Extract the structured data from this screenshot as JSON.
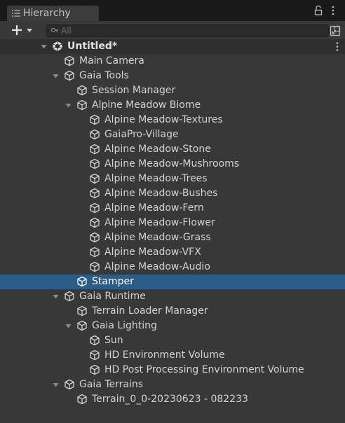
{
  "tab": {
    "title": "Hierarchy"
  },
  "search": {
    "placeholder": "All"
  },
  "rows": [
    {
      "label": "Untitled*",
      "depth": 0,
      "fold": "open",
      "scene": true
    },
    {
      "label": "Main Camera",
      "depth": 1,
      "fold": "none"
    },
    {
      "label": "Gaia Tools",
      "depth": 1,
      "fold": "open"
    },
    {
      "label": "Session Manager",
      "depth": 2,
      "fold": "none"
    },
    {
      "label": "Alpine Meadow Biome",
      "depth": 2,
      "fold": "open"
    },
    {
      "label": "Alpine Meadow-Textures",
      "depth": 3,
      "fold": "none"
    },
    {
      "label": "GaiaPro-Village",
      "depth": 3,
      "fold": "none"
    },
    {
      "label": "Alpine Meadow-Stone",
      "depth": 3,
      "fold": "none"
    },
    {
      "label": "Alpine Meadow-Mushrooms",
      "depth": 3,
      "fold": "none"
    },
    {
      "label": "Alpine Meadow-Trees",
      "depth": 3,
      "fold": "none"
    },
    {
      "label": "Alpine Meadow-Bushes",
      "depth": 3,
      "fold": "none"
    },
    {
      "label": "Alpine Meadow-Fern",
      "depth": 3,
      "fold": "none"
    },
    {
      "label": "Alpine Meadow-Flower",
      "depth": 3,
      "fold": "none"
    },
    {
      "label": "Alpine Meadow-Grass",
      "depth": 3,
      "fold": "none"
    },
    {
      "label": "Alpine Meadow-VFX",
      "depth": 3,
      "fold": "none"
    },
    {
      "label": "Alpine Meadow-Audio",
      "depth": 3,
      "fold": "none"
    },
    {
      "label": "Stamper",
      "depth": 2,
      "fold": "none",
      "selected": true
    },
    {
      "label": "Gaia Runtime",
      "depth": 1,
      "fold": "open"
    },
    {
      "label": "Terrain Loader Manager",
      "depth": 2,
      "fold": "none"
    },
    {
      "label": "Gaia Lighting",
      "depth": 2,
      "fold": "open"
    },
    {
      "label": "Sun",
      "depth": 3,
      "fold": "none"
    },
    {
      "label": "HD Environment Volume",
      "depth": 3,
      "fold": "none"
    },
    {
      "label": "HD Post Processing Environment Volume",
      "depth": 3,
      "fold": "none"
    },
    {
      "label": "Gaia Terrains",
      "depth": 1,
      "fold": "open"
    },
    {
      "label": "Terrain_0_0-20230623 - 082233",
      "depth": 2,
      "fold": "none"
    }
  ],
  "colors": {
    "panel_bg": "#383838",
    "selection": "#2c5d87",
    "text": "#d2d2d2"
  }
}
